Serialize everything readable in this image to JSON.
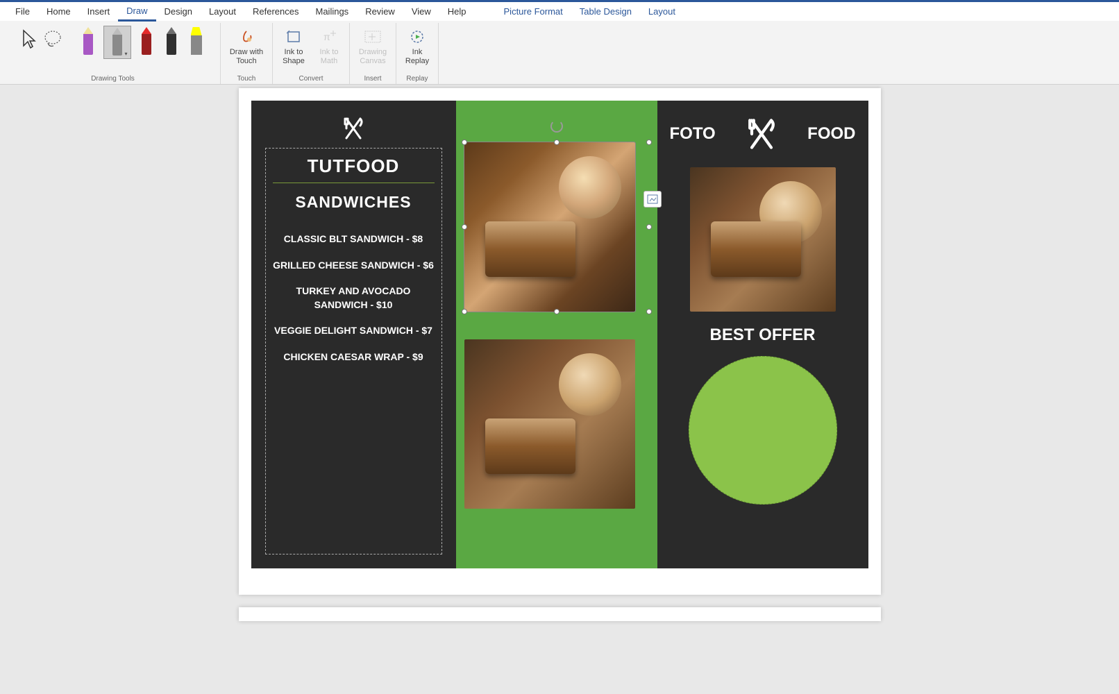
{
  "ribbon": {
    "tabs": [
      "File",
      "Home",
      "Insert",
      "Draw",
      "Design",
      "Layout",
      "References",
      "Mailings",
      "Review",
      "View",
      "Help"
    ],
    "contextual_tabs": [
      "Picture Format",
      "Table Design",
      "Layout"
    ],
    "active_tab": "Draw",
    "groups": {
      "drawing_tools": "Drawing Tools",
      "touch": "Touch",
      "convert": "Convert",
      "insert": "Insert",
      "replay": "Replay"
    },
    "buttons": {
      "draw_touch": "Draw with Touch",
      "ink_shape": "Ink to Shape",
      "ink_math": "Ink to Math",
      "drawing_canvas": "Drawing Canvas",
      "ink_replay": "Ink Replay"
    },
    "pens": [
      {
        "name": "pen-purple",
        "tip": "#f0e29a",
        "body": "#a858c4"
      },
      {
        "name": "pen-gray",
        "tip": "#bdbdbd",
        "body": "#8a8a8a",
        "selected": true
      },
      {
        "name": "pen-red",
        "tip": "#e52b2b",
        "body": "#9a1f1f"
      },
      {
        "name": "pen-black",
        "tip": "#6e6e6e",
        "body": "#303030"
      },
      {
        "name": "highlighter-yellow",
        "tip": "#ffff00",
        "body": "#888"
      }
    ]
  },
  "flyer": {
    "left": {
      "title": "TUTFOOD",
      "category": "SANDWICHES",
      "items": [
        "CLASSIC BLT SANDWICH - $8",
        "GRILLED CHEESE SANDWICH - $6",
        "TURKEY AND AVOCADO SANDWICH - $10",
        "VEGGIE DELIGHT SANDWICH - $7",
        "CHICKEN CAESAR WRAP - $9"
      ]
    },
    "right": {
      "logo_left": "FOTO",
      "logo_right": "FOOD",
      "best_offer": "BEST OFFER"
    }
  }
}
